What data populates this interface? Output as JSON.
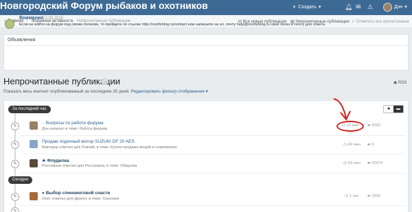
{
  "header": {
    "site_title": "Новгородский Форум рыбаков и охотников",
    "create_label": "Создать",
    "user_name": "Дэн",
    "icons": [
      "plus-icon",
      "bell-icon",
      "mail-icon",
      "warning-icon",
      "caret-down-icon"
    ]
  },
  "breadcrumb": {
    "items": [
      "Главная",
      "Форумная активность",
      "Непрочитанные публикации"
    ],
    "actions": [
      "Все новые публикации",
      "Непрочитанные публикации",
      "Отметить все прочитанным"
    ]
  },
  "announcements": {
    "heading": "Объявления",
    "title": "Внимание",
    "date": "13.09.2015",
    "text": "Если не войти на форум под своим логином, то пройдите по ссылке http://novfishing.ru/contact или напишите на эл. почту help@novfishing.ru свой логин и почту для ответа."
  },
  "page": {
    "title": "Непрочитанные публикации",
    "rss": "RSS",
    "desc": "Показать весь контент опубликованный за последние 30 дней.",
    "filter_link": "Редактировать фильтр отображения"
  },
  "feed": {
    "groups": [
      "За последний час",
      "Сегодня"
    ],
    "items": [
      {
        "title": "Вопросы по работе форума",
        "sub": "Дэн написал в теме: Работа форума",
        "time": "23 мин",
        "count": "2092",
        "unread": false
      },
      {
        "title": "Продам лодочный мотор SUZUKI DF 20 AES",
        "sub": "Викторыj ответил для Ловчий, в теме: Куплю-продажа вещей и снаряжения.",
        "time": "49 мин",
        "count": "3",
        "unread": false
      },
      {
        "title": "Флудилка",
        "sub": "Россомаха ответил для Россомаха, в теме: Общалка",
        "time": "59 мин",
        "count": "25974",
        "unread": true
      },
      {
        "title": "Выбор спиннинговой снасти",
        "sub": "Олег ответил для Джигит, в теме: Спиннинг",
        "time": "1 час",
        "count": "1855",
        "unread": true
      }
    ]
  },
  "colors": {
    "header": "#3d6a95",
    "link": "#2a5f8f",
    "annotation": "#d31e1e"
  }
}
